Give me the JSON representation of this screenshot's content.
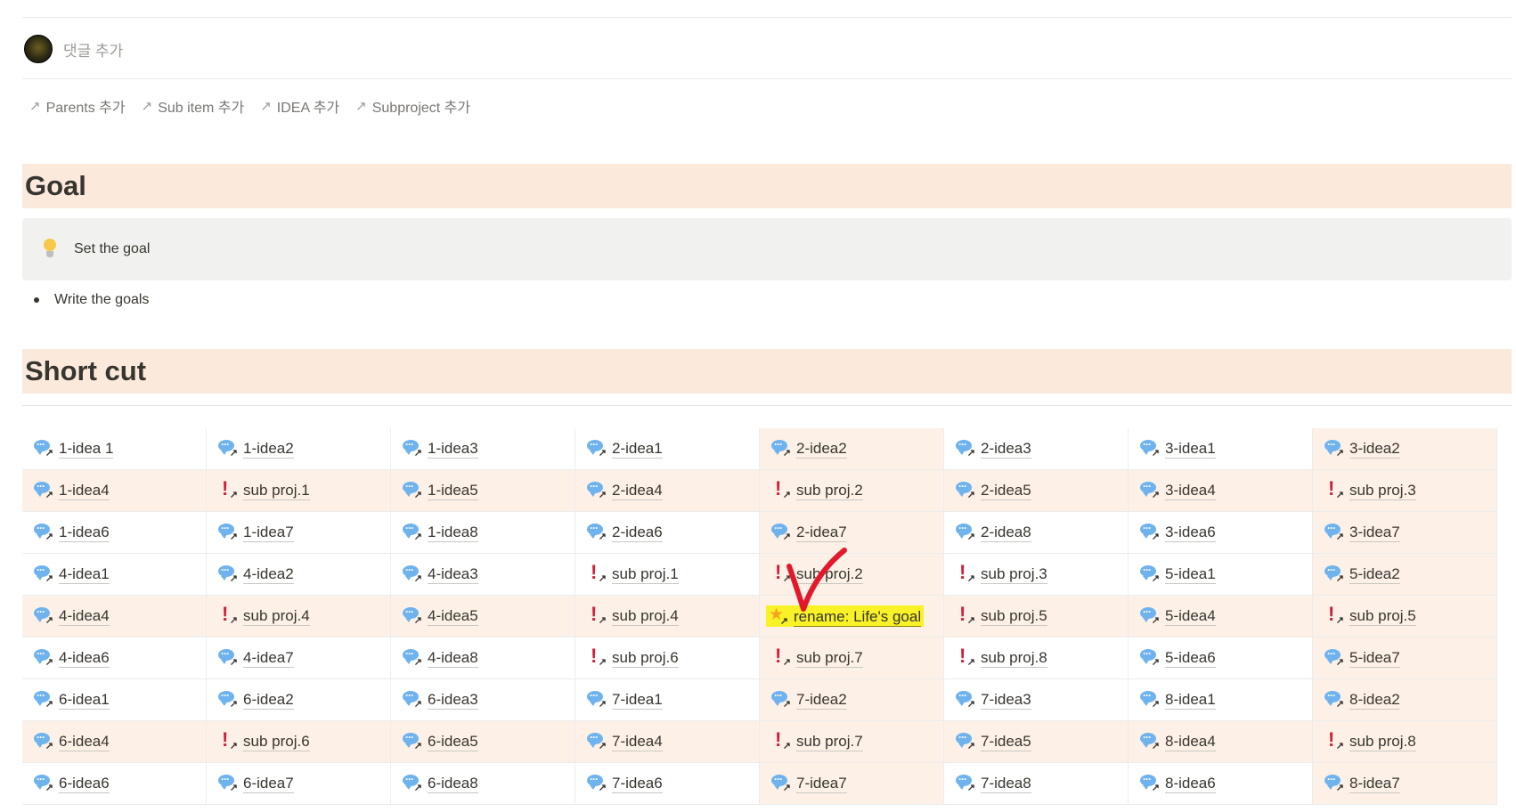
{
  "comment": {
    "placeholder": "댓글 추가"
  },
  "relations": [
    {
      "label": "Parents 추가"
    },
    {
      "label": "Sub item 추가"
    },
    {
      "label": "IDEA 추가"
    },
    {
      "label": "Subproject 추가"
    }
  ],
  "goal": {
    "heading": "Goal",
    "callout": "Set the goal",
    "bullet": "Write the goals"
  },
  "shortcut": {
    "heading": "Short cut",
    "rows": [
      [
        {
          "t": "i",
          "l": "1-idea 1"
        },
        {
          "t": "i",
          "l": "1-idea2"
        },
        {
          "t": "i",
          "l": "1-idea3"
        },
        {
          "t": "i",
          "l": "2-idea1"
        },
        {
          "t": "i",
          "l": "2-idea2"
        },
        {
          "t": "i",
          "l": "2-idea3"
        },
        {
          "t": "i",
          "l": "3-idea1"
        },
        {
          "t": "i",
          "l": "3-idea2"
        }
      ],
      [
        {
          "t": "i",
          "l": "1-idea4"
        },
        {
          "t": "p",
          "l": "sub proj.1"
        },
        {
          "t": "i",
          "l": "1-idea5"
        },
        {
          "t": "i",
          "l": "2-idea4"
        },
        {
          "t": "p",
          "l": "sub proj.2"
        },
        {
          "t": "i",
          "l": "2-idea5"
        },
        {
          "t": "i",
          "l": "3-idea4"
        },
        {
          "t": "p",
          "l": "sub proj.3"
        }
      ],
      [
        {
          "t": "i",
          "l": "1-idea6"
        },
        {
          "t": "i",
          "l": "1-idea7"
        },
        {
          "t": "i",
          "l": "1-idea8"
        },
        {
          "t": "i",
          "l": "2-idea6"
        },
        {
          "t": "i",
          "l": "2-idea7"
        },
        {
          "t": "i",
          "l": "2-idea8"
        },
        {
          "t": "i",
          "l": "3-idea6"
        },
        {
          "t": "i",
          "l": "3-idea7"
        }
      ],
      [
        {
          "t": "i",
          "l": "4-idea1"
        },
        {
          "t": "i",
          "l": "4-idea2"
        },
        {
          "t": "i",
          "l": "4-idea3"
        },
        {
          "t": "p",
          "l": "sub proj.1"
        },
        {
          "t": "p",
          "l": "sub proj.2"
        },
        {
          "t": "p",
          "l": "sub proj.3"
        },
        {
          "t": "i",
          "l": "5-idea1"
        },
        {
          "t": "i",
          "l": "5-idea2"
        }
      ],
      [
        {
          "t": "i",
          "l": "4-idea4"
        },
        {
          "t": "p",
          "l": "sub proj.4"
        },
        {
          "t": "i",
          "l": "4-idea5"
        },
        {
          "t": "p",
          "l": "sub proj.4"
        },
        {
          "t": "s",
          "l": "rename: Life's goal"
        },
        {
          "t": "p",
          "l": "sub proj.5"
        },
        {
          "t": "i",
          "l": "5-idea4"
        },
        {
          "t": "p",
          "l": "sub proj.5"
        }
      ],
      [
        {
          "t": "i",
          "l": "4-idea6"
        },
        {
          "t": "i",
          "l": "4-idea7"
        },
        {
          "t": "i",
          "l": "4-idea8"
        },
        {
          "t": "p",
          "l": "sub proj.6"
        },
        {
          "t": "p",
          "l": "sub proj.7"
        },
        {
          "t": "p",
          "l": "sub proj.8"
        },
        {
          "t": "i",
          "l": "5-idea6"
        },
        {
          "t": "i",
          "l": "5-idea7"
        }
      ],
      [
        {
          "t": "i",
          "l": "6-idea1"
        },
        {
          "t": "i",
          "l": "6-idea2"
        },
        {
          "t": "i",
          "l": "6-idea3"
        },
        {
          "t": "i",
          "l": "7-idea1"
        },
        {
          "t": "i",
          "l": "7-idea2"
        },
        {
          "t": "i",
          "l": "7-idea3"
        },
        {
          "t": "i",
          "l": "8-idea1"
        },
        {
          "t": "i",
          "l": "8-idea2"
        }
      ],
      [
        {
          "t": "i",
          "l": "6-idea4"
        },
        {
          "t": "p",
          "l": "sub proj.6"
        },
        {
          "t": "i",
          "l": "6-idea5"
        },
        {
          "t": "i",
          "l": "7-idea4"
        },
        {
          "t": "p",
          "l": "sub proj.7"
        },
        {
          "t": "i",
          "l": "7-idea5"
        },
        {
          "t": "i",
          "l": "8-idea4"
        },
        {
          "t": "p",
          "l": "sub proj.8"
        }
      ],
      [
        {
          "t": "i",
          "l": "6-idea6"
        },
        {
          "t": "i",
          "l": "6-idea7"
        },
        {
          "t": "i",
          "l": "6-idea8"
        },
        {
          "t": "i",
          "l": "7-idea6"
        },
        {
          "t": "i",
          "l": "7-idea7"
        },
        {
          "t": "i",
          "l": "7-idea8"
        },
        {
          "t": "i",
          "l": "8-idea6"
        },
        {
          "t": "i",
          "l": "8-idea7"
        }
      ]
    ],
    "tinted_rows": [
      1,
      4,
      7
    ],
    "tinted_cols": [
      4,
      7
    ],
    "highlight_color": "#f8f227",
    "annotation_color": "#e3182b"
  }
}
